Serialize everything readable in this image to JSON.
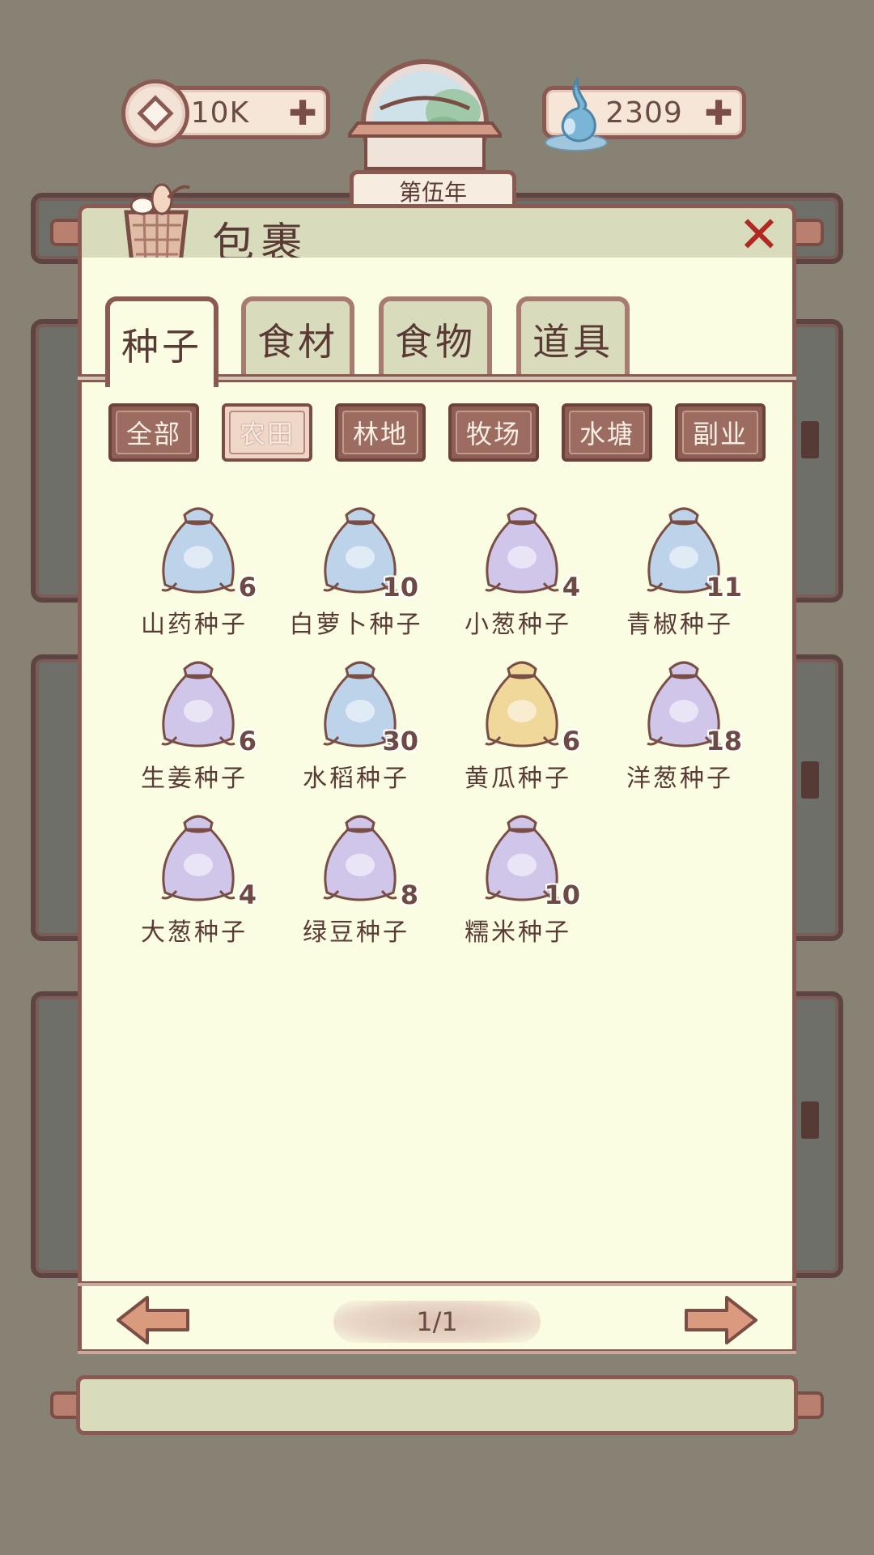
{
  "hud": {
    "coins": "10K",
    "water": "2309",
    "year_label": "第伍年"
  },
  "panel": {
    "title": "包裹"
  },
  "tabs": [
    {
      "label": "种子",
      "active": true
    },
    {
      "label": "食材",
      "active": false
    },
    {
      "label": "食物",
      "active": false
    },
    {
      "label": "道具",
      "active": false
    }
  ],
  "filters": [
    {
      "label": "全部",
      "active": false
    },
    {
      "label": "农田",
      "active": true
    },
    {
      "label": "林地",
      "active": false
    },
    {
      "label": "牧场",
      "active": false
    },
    {
      "label": "水塘",
      "active": false
    },
    {
      "label": "副业",
      "active": false
    }
  ],
  "items": [
    {
      "name": "山药种子",
      "count": "6",
      "icon": "yam-seed-bag-icon",
      "bag_color": "#bcd3ea"
    },
    {
      "name": "白萝卜种子",
      "count": "10",
      "icon": "radish-seed-bag-icon",
      "bag_color": "#bcd3ea"
    },
    {
      "name": "小葱种子",
      "count": "4",
      "icon": "scallion-seed-bag-icon",
      "bag_color": "#cfc6ea"
    },
    {
      "name": "青椒种子",
      "count": "11",
      "icon": "green-pepper-seed-bag-icon",
      "bag_color": "#bcd3ea"
    },
    {
      "name": "生姜种子",
      "count": "6",
      "icon": "ginger-seed-bag-icon",
      "bag_color": "#cfc6ea"
    },
    {
      "name": "水稻种子",
      "count": "30",
      "icon": "rice-seed-bag-icon",
      "bag_color": "#bcd3ea"
    },
    {
      "name": "黄瓜种子",
      "count": "6",
      "icon": "cucumber-seed-bag-icon",
      "bag_color": "#f0d79a"
    },
    {
      "name": "洋葱种子",
      "count": "18",
      "icon": "onion-seed-bag-icon",
      "bag_color": "#cfc6ea"
    },
    {
      "name": "大葱种子",
      "count": "4",
      "icon": "leek-seed-bag-icon",
      "bag_color": "#cfc6ea"
    },
    {
      "name": "绿豆种子",
      "count": "8",
      "icon": "mung-bean-seed-bag-icon",
      "bag_color": "#cfc6ea"
    },
    {
      "name": "糯米种子",
      "count": "10",
      "icon": "glutinous-rice-seed-bag-icon",
      "bag_color": "#cfc6ea"
    }
  ],
  "pagination": {
    "label": "1/1"
  },
  "colors": {
    "panel_bg": "#fbfde2",
    "frame": "#8a5a52",
    "header_bg": "#d8dcbd",
    "close_red": "#b02a22"
  }
}
